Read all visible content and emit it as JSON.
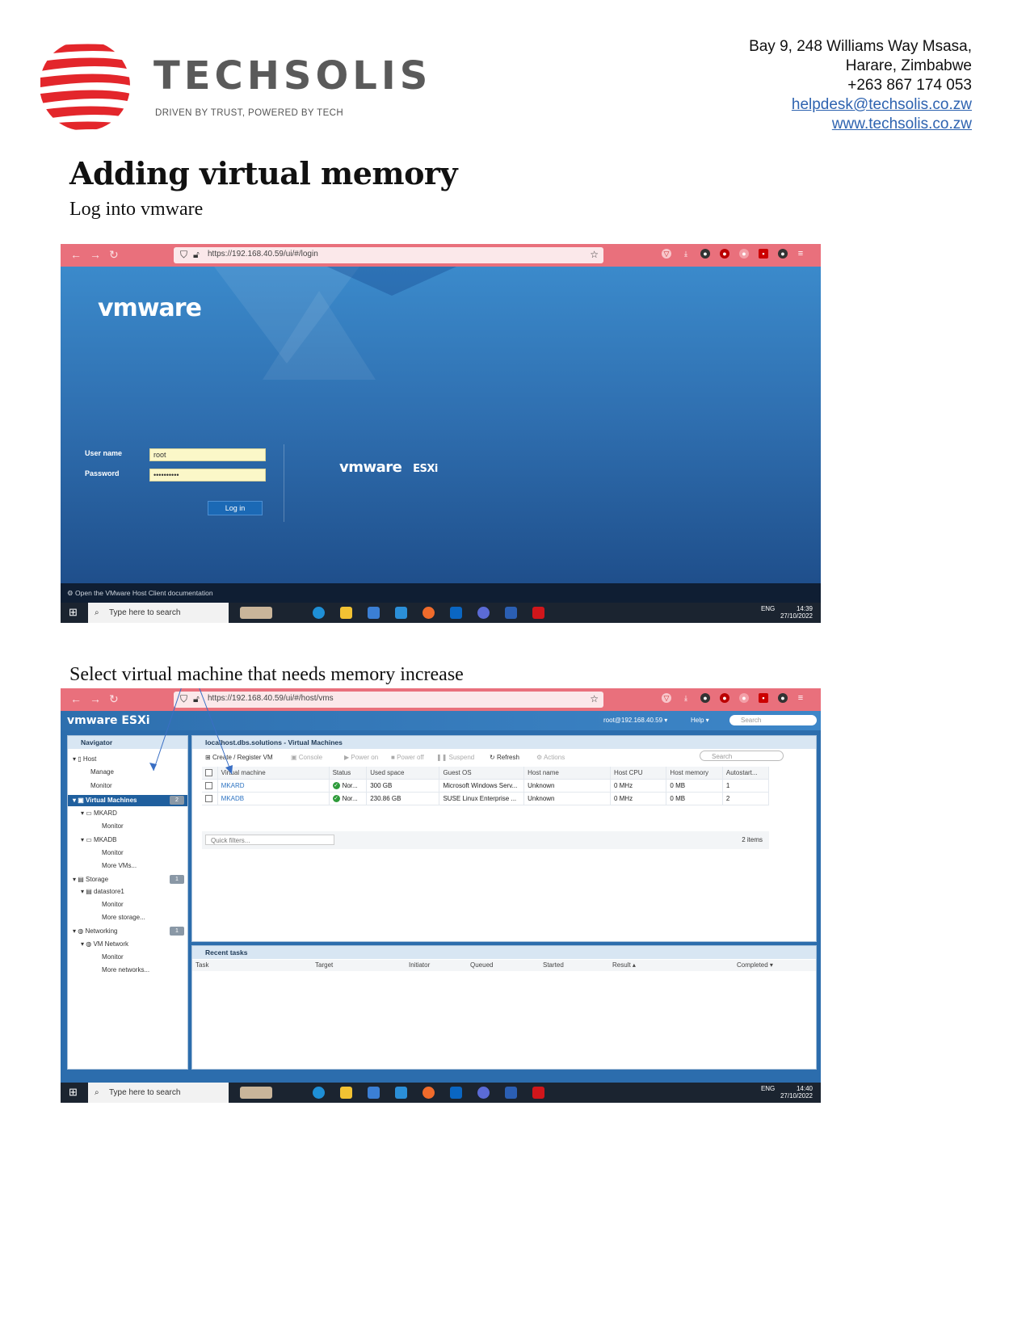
{
  "header": {
    "brand": "TECHSOLIS",
    "tagline": "DRIVEN BY TRUST, POWERED BY TECH",
    "address_line1": "Bay 9, 248 Williams Way Msasa,",
    "address_line2": "Harare, Zimbabwe",
    "phone": "+263 867 174 053",
    "email": "helpdesk@techsolis.co.zw",
    "website": "www.techsolis.co.zw"
  },
  "doc": {
    "title": "Adding virtual memory",
    "step1": "Log into vmware",
    "step2": "Select virtual machine that needs memory increase"
  },
  "shot1": {
    "url": "https://192.168.40.59/ui/#/login",
    "logo": "vmware",
    "logo_esxi": "ESXi",
    "username_label": "User name",
    "password_label": "Password",
    "username_value": "root",
    "password_value": "••••••••••",
    "login_button": "Log in",
    "doc_link": "Open the VMware Host Client documentation",
    "taskbar_search": "Type here to search",
    "tray_lang": "ENG",
    "tray_time": "14:39",
    "tray_date": "27/10/2022"
  },
  "shot2": {
    "url": "https://192.168.40.59/ui/#/host/vms",
    "brand": "vmware ESXi",
    "user": "root@192.168.40.59 ▾",
    "help": "Help ▾",
    "search_placeholder": "Search",
    "navigator_title": "Navigator",
    "nav": {
      "host": "Host",
      "manage": "Manage",
      "monitor": "Monitor",
      "virtual_machines": "Virtual Machines",
      "vm_count": "2",
      "vm1": "MKARD",
      "vm1_monitor": "Monitor",
      "vm2": "MKADB",
      "vm2_monitor": "Monitor",
      "more_vms": "More VMs...",
      "storage": "Storage",
      "storage_count": "1",
      "datastore": "datastore1",
      "ds_monitor": "Monitor",
      "more_storage": "More storage...",
      "networking": "Networking",
      "net_count": "1",
      "vm_network": "VM Network",
      "net_monitor": "Monitor",
      "more_networks": "More networks..."
    },
    "main_title": "localhost.dbs.solutions - Virtual Machines",
    "toolbar": {
      "create": "Create / Register VM",
      "console": "Console",
      "power_on": "Power on",
      "power_off": "Power off",
      "suspend": "Suspend",
      "refresh": "Refresh",
      "actions": "Actions"
    },
    "table_search": "Search",
    "columns": [
      "Virtual machine",
      "Status",
      "Used space",
      "Guest OS",
      "Host name",
      "Host CPU",
      "Host memory",
      "Autostart..."
    ],
    "rows": [
      [
        "MKARD",
        "Nor...",
        "300 GB",
        "Microsoft Windows Serv...",
        "Unknown",
        "0 MHz",
        "0 MB",
        "1"
      ],
      [
        "MKADB",
        "Nor...",
        "230.86 GB",
        "SUSE Linux Enterprise ...",
        "Unknown",
        "0 MHz",
        "0 MB",
        "2"
      ]
    ],
    "quick_filters": "Quick filters...",
    "items_count": "2 items",
    "recent_tasks": "Recent tasks",
    "task_columns": [
      "Task",
      "Target",
      "Initiator",
      "Queued",
      "Started",
      "Result ▴",
      "Completed ▾"
    ],
    "taskbar_search": "Type here to search",
    "tray_lang": "ENG",
    "tray_time": "14:40",
    "tray_date": "27/10/2022"
  },
  "colors": {
    "brand_red": "#e3262b",
    "firefox_bar": "#e9707c",
    "vmware_blue": "#2f6fb0",
    "link_blue": "#2e63b0"
  }
}
